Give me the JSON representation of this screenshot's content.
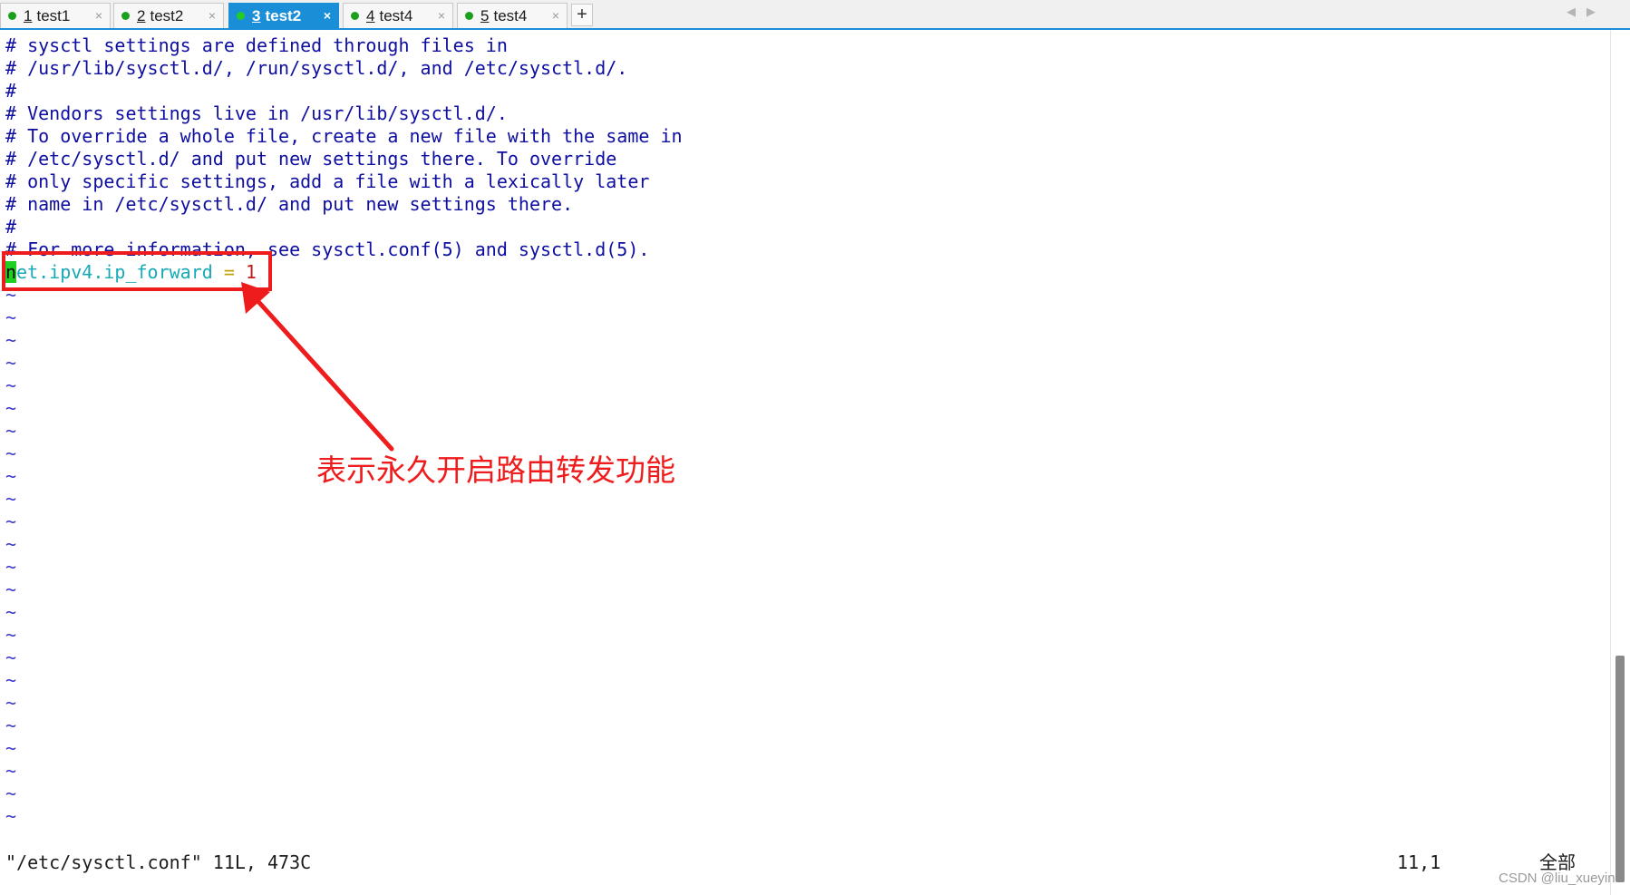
{
  "tabs": [
    {
      "number": "1",
      "name": "test1",
      "close": "×"
    },
    {
      "number": "2",
      "name": "test2",
      "close": "×"
    },
    {
      "number": "3",
      "name": "test2",
      "close": "×",
      "active": true
    },
    {
      "number": "4",
      "name": "test4",
      "close": "×"
    },
    {
      "number": "5",
      "name": "test4",
      "close": "×"
    }
  ],
  "tab_add_label": "+",
  "tab_nav": {
    "prev": "◀",
    "next": "▶"
  },
  "editor": {
    "comment_lines": [
      "# sysctl settings are defined through files in",
      "# /usr/lib/sysctl.d/, /run/sysctl.d/, and /etc/sysctl.d/.",
      "#",
      "# Vendors settings live in /usr/lib/sysctl.d/.",
      "# To override a whole file, create a new file with the same in",
      "# /etc/sysctl.d/ and put new settings there. To override",
      "# only specific settings, add a file with a lexically later",
      "# name in /etc/sysctl.d/ and put new settings there.",
      "#",
      "# For more information, see sysctl.conf(5) and sysctl.d(5)."
    ],
    "setting": {
      "cursor_char": "n",
      "key_rest": "et.ipv4.ip_forward",
      "eq": " = ",
      "value": "1"
    },
    "tilde_char": "~"
  },
  "annotation": {
    "text": "表示永久开启路由转发功能",
    "color": "#ee1c1c"
  },
  "status": {
    "file_info": "\"/etc/sysctl.conf\" 11L, 473C",
    "position": "11,1",
    "scroll": "全部"
  },
  "watermark": "CSDN @liu_xueyin",
  "colors": {
    "active_tab": "#1a8fd8",
    "comment": "#0e0ea0",
    "key": "#16a9b7",
    "value": "#c41a1a",
    "cursor": "#1fcf22"
  }
}
